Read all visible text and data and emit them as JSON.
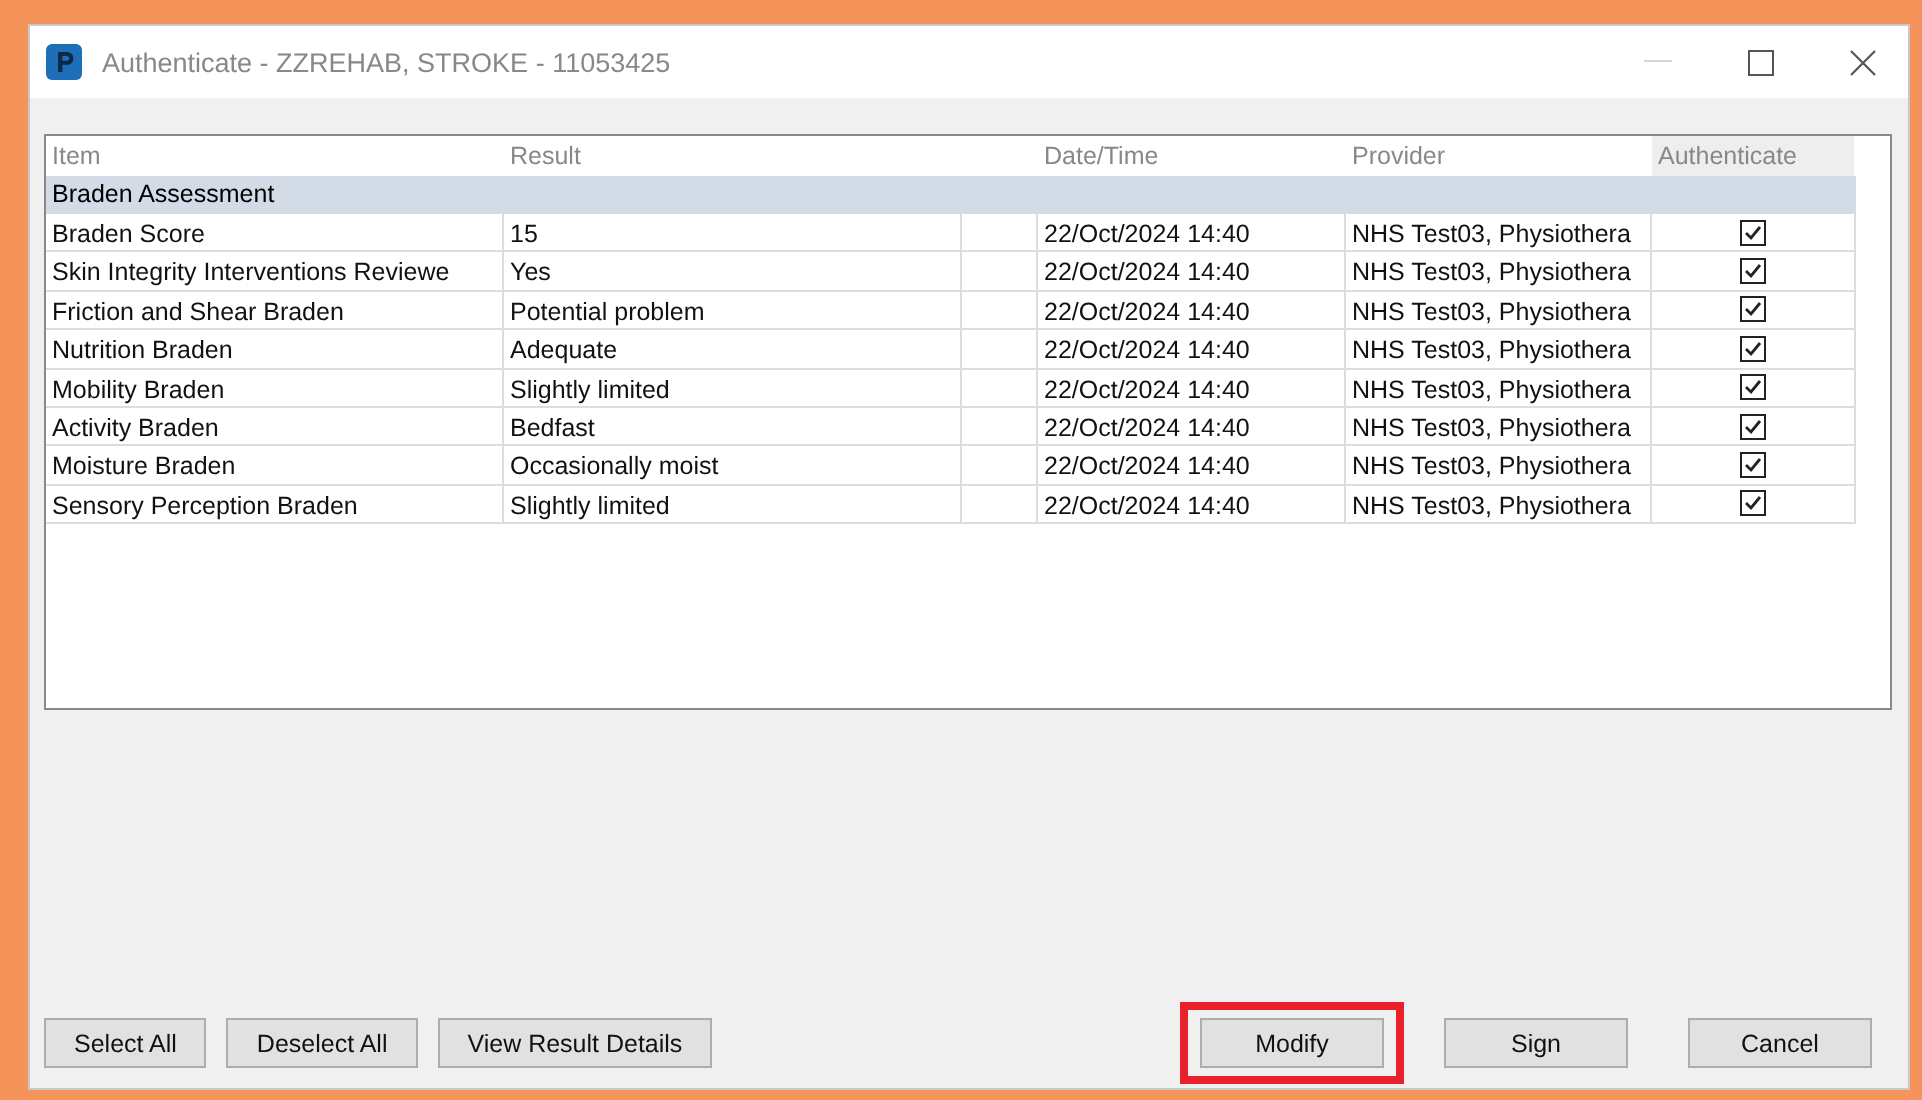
{
  "window": {
    "title": "Authenticate - ZZREHAB, STROKE - 11053425"
  },
  "table": {
    "columns": [
      "Item",
      "Result",
      "Date/Time",
      "Provider",
      "Authenticate"
    ],
    "group": "Braden Assessment",
    "rows": [
      {
        "item": "Braden Score",
        "result": "15",
        "datetime": "22/Oct/2024 14:40",
        "provider": "NHS Test03, Physiothera",
        "checked": true
      },
      {
        "item": "Skin Integrity Interventions Reviewe",
        "result": "Yes",
        "datetime": "22/Oct/2024 14:40",
        "provider": "NHS Test03, Physiothera",
        "checked": true
      },
      {
        "item": "Friction and Shear Braden",
        "result": "Potential problem",
        "datetime": "22/Oct/2024 14:40",
        "provider": "NHS Test03, Physiothera",
        "checked": true
      },
      {
        "item": "Nutrition Braden",
        "result": "Adequate",
        "datetime": "22/Oct/2024 14:40",
        "provider": "NHS Test03, Physiothera",
        "checked": true
      },
      {
        "item": "Mobility Braden",
        "result": "Slightly limited",
        "datetime": "22/Oct/2024 14:40",
        "provider": "NHS Test03, Physiothera",
        "checked": true
      },
      {
        "item": "Activity Braden",
        "result": "Bedfast",
        "datetime": "22/Oct/2024 14:40",
        "provider": "NHS Test03, Physiothera",
        "checked": true
      },
      {
        "item": "Moisture Braden",
        "result": "Occasionally moist",
        "datetime": "22/Oct/2024 14:40",
        "provider": "NHS Test03, Physiothera",
        "checked": true
      },
      {
        "item": "Sensory Perception Braden",
        "result": "Slightly limited",
        "datetime": "22/Oct/2024 14:40",
        "provider": "NHS Test03, Physiothera",
        "checked": true
      }
    ]
  },
  "left_buttons": [
    {
      "label": "Select All"
    },
    {
      "label": "Deselect All"
    },
    {
      "label": "View Result Details"
    }
  ],
  "right_buttons": [
    {
      "label": "Modify",
      "highlighted": true
    },
    {
      "label": "Sign",
      "highlighted": false
    },
    {
      "label": "Cancel",
      "highlighted": false
    }
  ]
}
